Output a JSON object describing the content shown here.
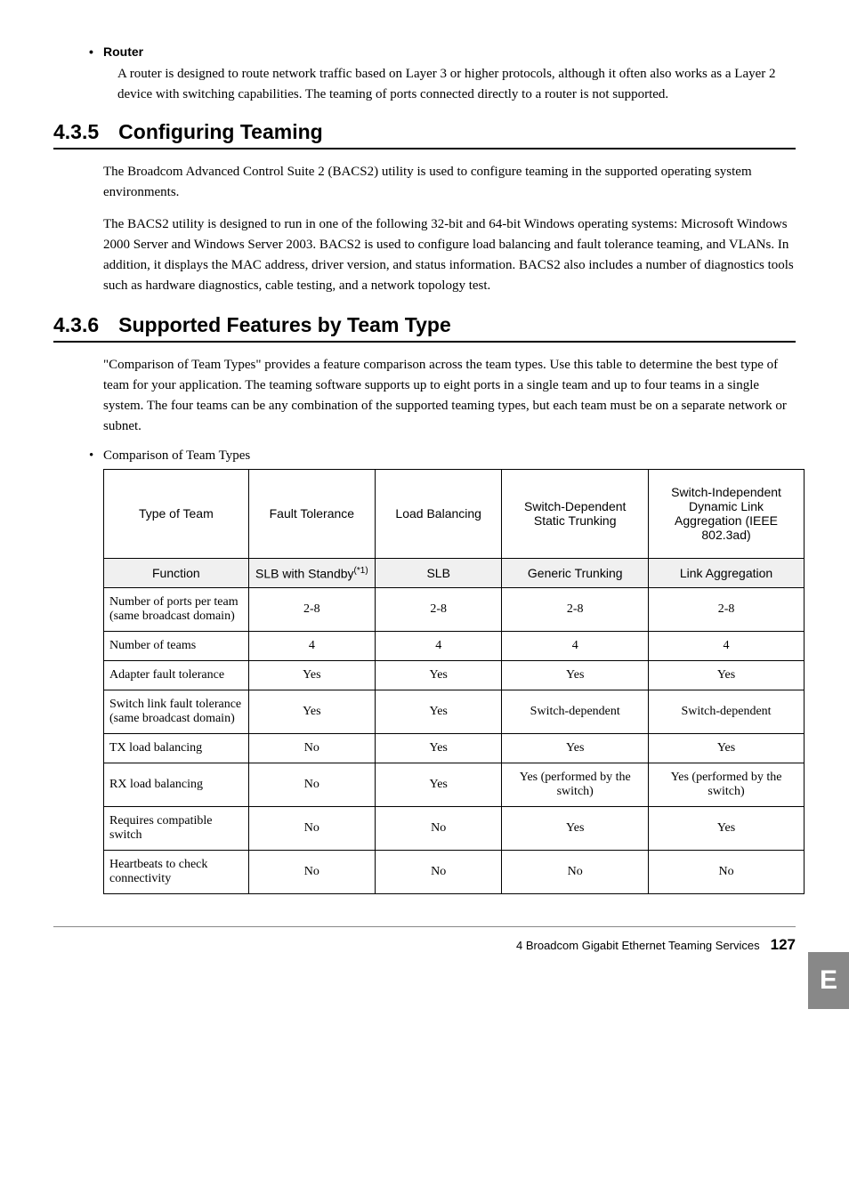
{
  "router": {
    "title": "Router",
    "body": "A router is designed to route network traffic based on Layer 3 or higher protocols, although it often also works as a Layer 2 device with switching capabilities. The teaming of ports connected directly to a router is not supported."
  },
  "sec435": {
    "num": "4.3.5",
    "title": "Configuring Teaming",
    "p1": "The Broadcom Advanced Control Suite 2 (BACS2) utility is used to configure teaming in the supported operating system environments.",
    "p2": "The BACS2 utility is designed to run in one of the following 32-bit and 64-bit Windows operating systems: Microsoft Windows 2000 Server and Windows Server 2003. BACS2 is used to configure load balancing and fault tolerance teaming, and VLANs. In addition, it displays the MAC address, driver version, and status information. BACS2 also includes a number of diagnostics tools such as hardware diagnostics, cable testing, and a network topology test."
  },
  "sec436": {
    "num": "4.3.6",
    "title": "Supported Features by Team Type",
    "p1": "\"Comparison of Team Types\" provides a feature comparison across the team types. Use this table to determine the best type of team for your application. The teaming software supports up to eight ports in a single team and up to four teams in a single system. The four teams can be any combination of the supported teaming types, but each team must be on a separate network or subnet.",
    "list_intro": "Comparison of Team Types"
  },
  "table": {
    "headers": {
      "c0": "Type of Team",
      "c1": "Fault Tolerance",
      "c2": "Load Balancing",
      "c3": "Switch-Dependent Static Trunking",
      "c4": "Switch-Independent Dynamic Link Aggregation (IEEE 802.3ad)"
    },
    "func": {
      "c0": "Function",
      "c1_pre": "SLB with Standby",
      "c1_sup": "(*1)",
      "c2": "SLB",
      "c3": "Generic Trunking",
      "c4": "Link Aggregation"
    },
    "rows": [
      {
        "c0": "Number of ports per team (same broadcast domain)",
        "c1": "2-8",
        "c2": "2-8",
        "c3": "2-8",
        "c4": "2-8"
      },
      {
        "c0": "Number of teams",
        "c1": "4",
        "c2": "4",
        "c3": "4",
        "c4": "4"
      },
      {
        "c0": "Adapter fault tolerance",
        "c1": "Yes",
        "c2": "Yes",
        "c3": "Yes",
        "c4": "Yes"
      },
      {
        "c0": "Switch link fault tolerance (same broadcast domain)",
        "c1": "Yes",
        "c2": "Yes",
        "c3": "Switch-dependent",
        "c4": "Switch-dependent"
      },
      {
        "c0": "TX load balancing",
        "c1": "No",
        "c2": "Yes",
        "c3": "Yes",
        "c4": "Yes"
      },
      {
        "c0": "RX load balancing",
        "c1": "No",
        "c2": "Yes",
        "c3": "Yes (performed by the switch)",
        "c4": "Yes (performed by the switch)"
      },
      {
        "c0": "Requires compatible switch",
        "c1": "No",
        "c2": "No",
        "c3": "Yes",
        "c4": "Yes"
      },
      {
        "c0": "Heartbeats to check connectivity",
        "c1": "No",
        "c2": "No",
        "c3": "No",
        "c4": "No"
      }
    ]
  },
  "sidetab": "E",
  "footer": {
    "chapter": "4  Broadcom Gigabit Ethernet Teaming Services",
    "page": "127"
  }
}
